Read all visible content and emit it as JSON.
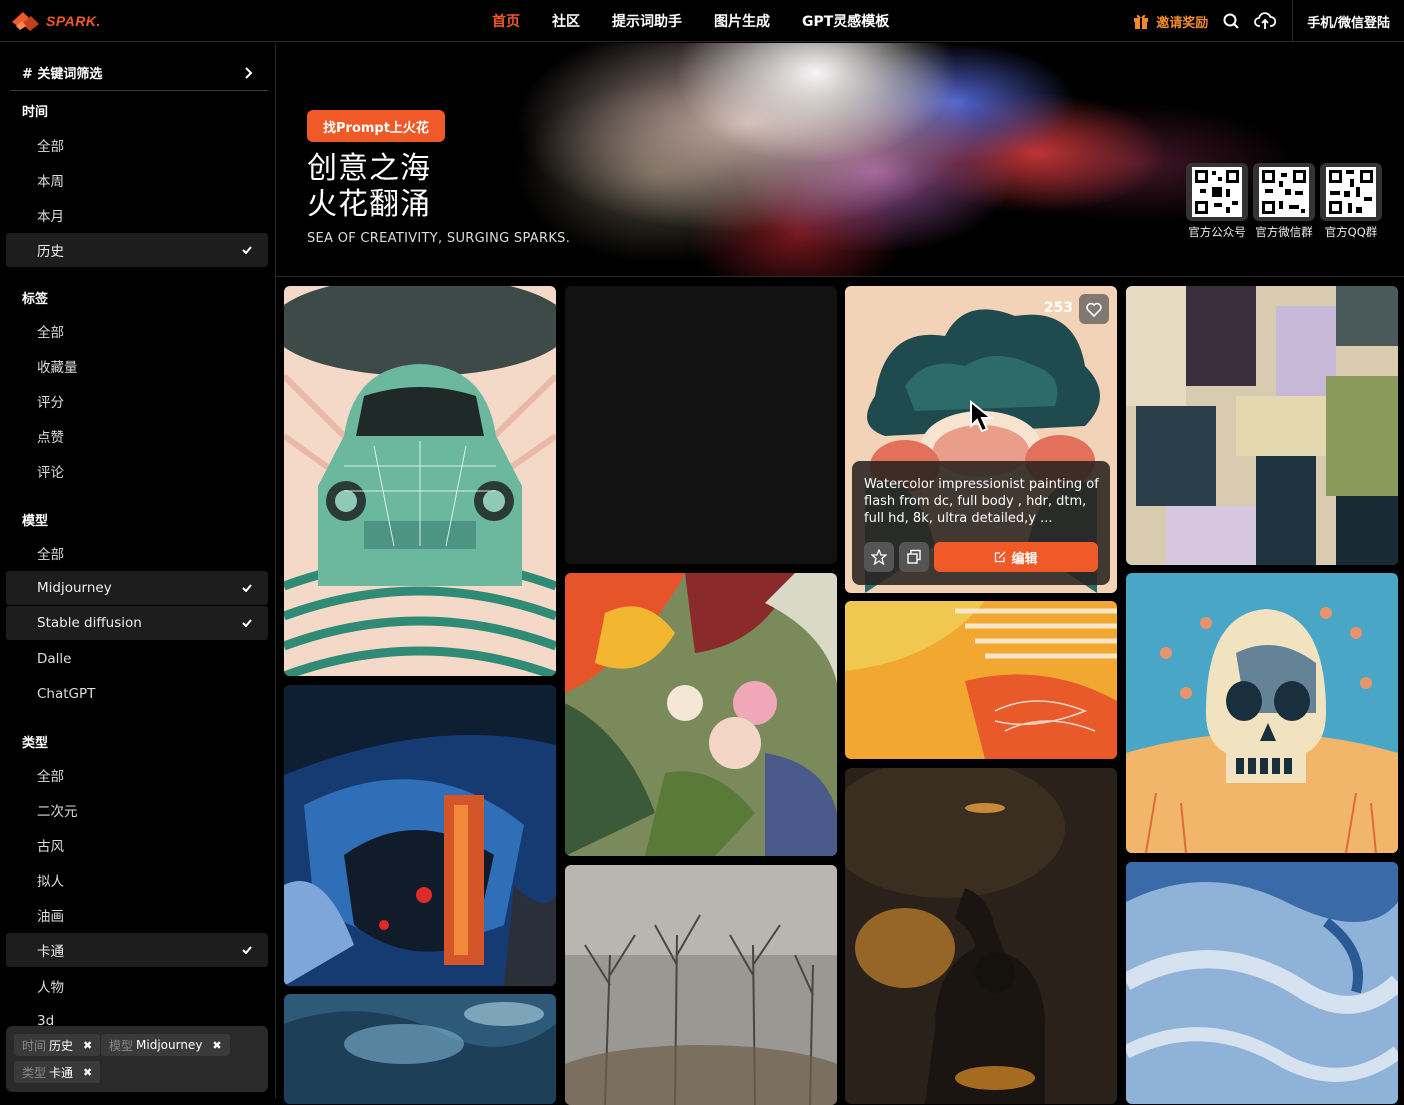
{
  "header": {
    "logo_text": "SPARK.",
    "nav": [
      "首页",
      "社区",
      "提示词助手",
      "图片生成",
      "GPT灵感模板"
    ],
    "active_nav": "首页",
    "invite_label": "邀请奖励",
    "login_label": "手机/微信登陆",
    "icons": [
      "gift-icon",
      "search-icon",
      "cloud-upload-icon"
    ]
  },
  "sidebar": {
    "keyword_filter": "# 关键词筛选",
    "sections": [
      {
        "title": "时间",
        "options": [
          "全部",
          "本周",
          "本月",
          "历史"
        ],
        "selected": [
          "历史"
        ]
      },
      {
        "title": "标签",
        "options": [
          "全部",
          "收藏量",
          "评分",
          "点赞",
          "评论"
        ],
        "selected": []
      },
      {
        "title": "模型",
        "options": [
          "全部",
          "Midjourney",
          "Stable diffusion",
          "Dalle",
          "ChatGPT"
        ],
        "selected": [
          "Midjourney",
          "Stable diffusion"
        ]
      },
      {
        "title": "类型",
        "options": [
          "全部",
          "二次元",
          "古风",
          "拟人",
          "油画",
          "卡通",
          "人物",
          "3d"
        ],
        "selected": [
          "卡通"
        ]
      }
    ],
    "active_filters": [
      {
        "key": "时间",
        "value": "历史"
      },
      {
        "key": "模型",
        "value": "Midjourney"
      },
      {
        "key": "类型",
        "value": "卡通"
      }
    ]
  },
  "hero": {
    "badge": "找Prompt上火花",
    "title_line1": "创意之海",
    "title_line2": "火花翻涌",
    "subtitle": "SEA OF CREATIVITY, SURGING SPARKS.",
    "qr_codes": [
      "官方公众号",
      "官方微信群",
      "官方QQ群"
    ]
  },
  "gallery": {
    "hover_card": {
      "likes": "253",
      "prompt": "Watercolor impressionist painting of flash from dc, full body , hdr, dtm, full hd, 8k, ultra detailed,y ...",
      "edit_label": "编辑"
    }
  },
  "colors": {
    "accent": "#f05a28",
    "background": "#000000",
    "panel": "#1d1d1d"
  }
}
